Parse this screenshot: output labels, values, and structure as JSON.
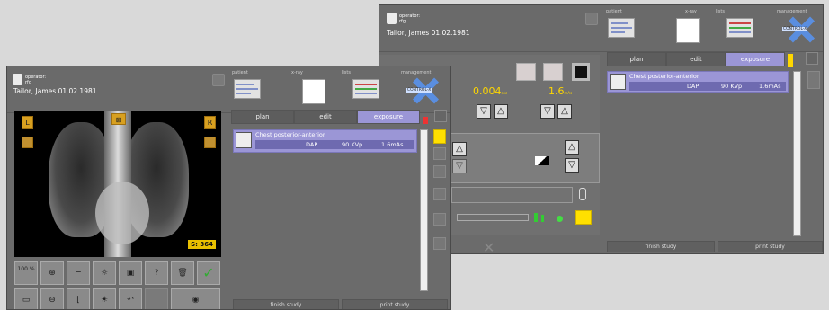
{
  "colors": {
    "accent": "#9b96d6",
    "yellow": "#ffe000",
    "gold": "#ffd700"
  },
  "back": {
    "operator": "operator:",
    "operator_id": "rfg",
    "patient": "Tailor,  James  01.02.1981",
    "nav": {
      "patient": "patient",
      "xray": "x-ray",
      "lists": "lists",
      "management": "management",
      "mgmt_logo": "CONTROL-X"
    },
    "tabs": [
      "plan",
      "edit",
      "exposure"
    ],
    "exam": {
      "title": "Chest posterior-anterior",
      "dap": "DAP",
      "kvp": "90 KVp",
      "mas": "1.6mAs"
    },
    "values": {
      "val1": "0.004",
      "val1_unit": "sec",
      "val2": "1.6",
      "val2_unit": "mAs"
    },
    "footer": {
      "finish": "finish study",
      "print": "print study"
    }
  },
  "front": {
    "operator": "operator:",
    "operator_id": "rfg",
    "patient": "Tailor,  James  01.02.1981",
    "nav": {
      "patient": "patient",
      "xray": "x-ray",
      "lists": "lists",
      "management": "management",
      "mgmt_logo": "CONTROL-X"
    },
    "tabs": [
      "plan",
      "edit",
      "exposure"
    ],
    "exam": {
      "title": "Chest posterior-anterior",
      "dap": "DAP",
      "kvp": "90 KVp",
      "mas": "1.6mAs"
    },
    "image": {
      "left": "L",
      "right": "R",
      "counter": "S: 364"
    },
    "tools": {
      "zoom100": "100 %"
    },
    "footer": {
      "finish": "finish study",
      "print": "print study"
    }
  }
}
